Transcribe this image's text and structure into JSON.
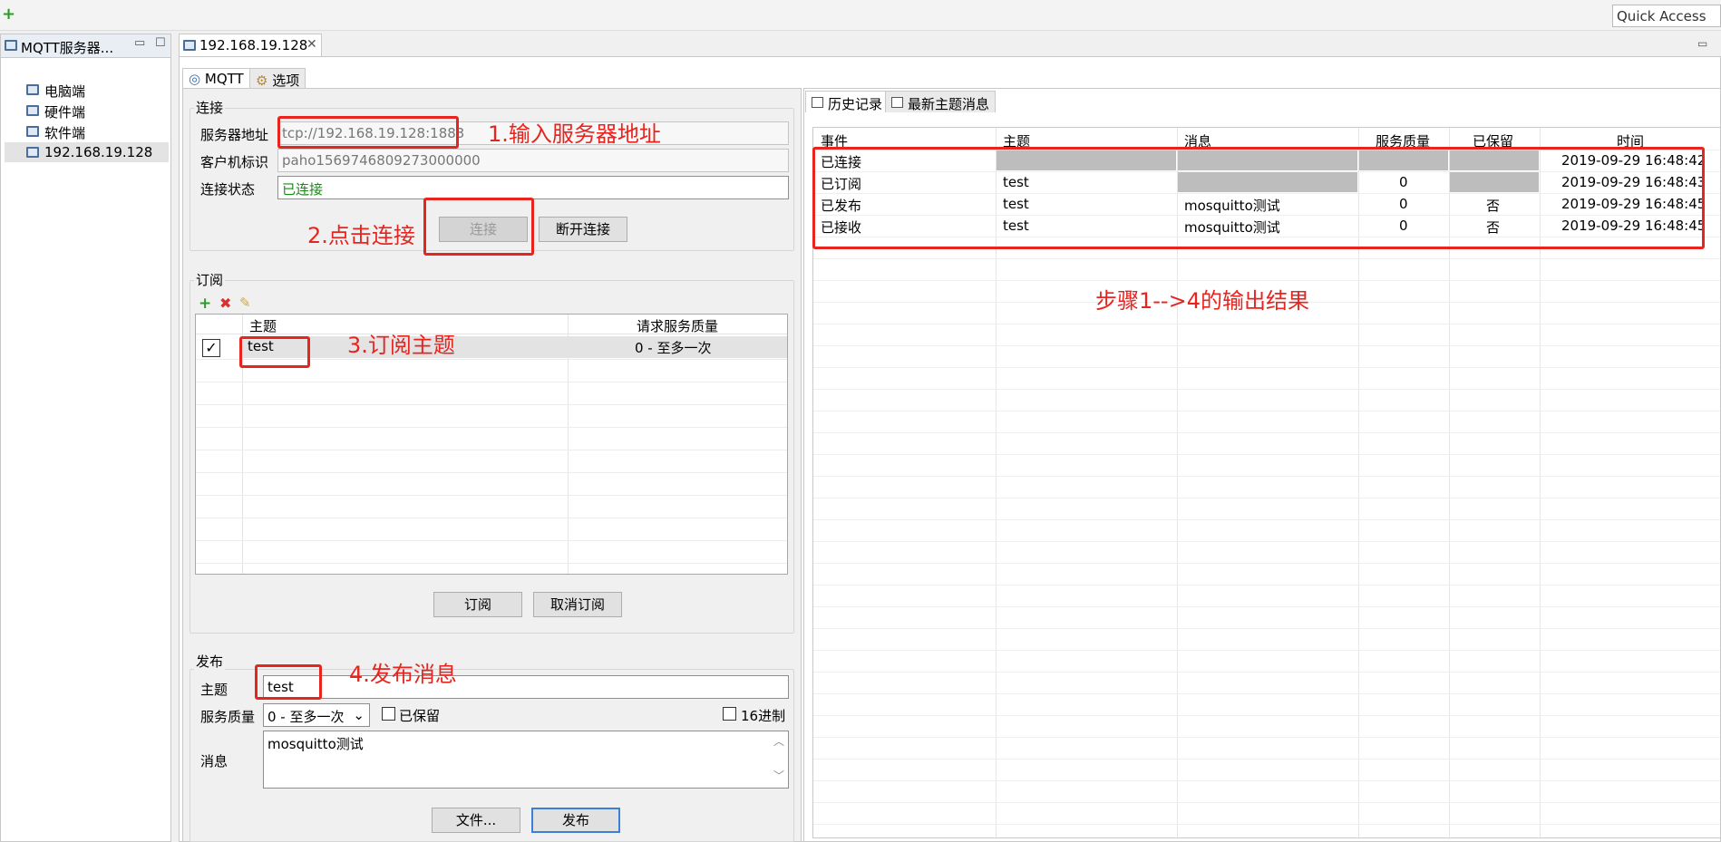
{
  "toolbar": {
    "quick_access_placeholder": "Quick Access"
  },
  "left_panel": {
    "title": "MQTT服务器...",
    "items": [
      "电脑端",
      "硬件端",
      "软件端",
      "192.168.19.128"
    ]
  },
  "editor": {
    "tab_title": "192.168.19.128",
    "inner_tabs": [
      "MQTT",
      "选项"
    ]
  },
  "connection": {
    "group_title": "连接",
    "server_label": "服务器地址",
    "server_value": "tcp://192.168.19.128:1883",
    "client_label": "客户机标识",
    "client_value": "paho1569746809273000000",
    "status_label": "连接状态",
    "status_value": "已连接",
    "connect_btn": "连接",
    "disconnect_btn": "断开连接"
  },
  "subscribe": {
    "group_title": "订阅",
    "col_topic": "主题",
    "col_qos": "请求服务质量",
    "rows": [
      {
        "checked": true,
        "topic": "test",
        "qos": "0 - 至多一次"
      }
    ],
    "subscribe_btn": "订阅",
    "unsubscribe_btn": "取消订阅"
  },
  "publish": {
    "group_title": "发布",
    "topic_label": "主题",
    "topic_value": "test",
    "qos_label": "服务质量",
    "qos_value": "0 - 至多一次",
    "retain_label": "已保留",
    "hex_label": "16进制",
    "message_label": "消息",
    "message_value": "mosquitto测试",
    "file_btn": "文件...",
    "publish_btn": "发布"
  },
  "history": {
    "tabs": [
      "历史记录",
      "最新主题消息"
    ],
    "columns": [
      "事件",
      "主题",
      "消息",
      "服务质量",
      "已保留",
      "时间"
    ],
    "rows": [
      {
        "event": "已连接",
        "topic": "",
        "message": "",
        "qos": "",
        "retained": "",
        "time": "2019-09-29 16:48:42"
      },
      {
        "event": "已订阅",
        "topic": "test",
        "message": "",
        "qos": "0",
        "retained": "",
        "time": "2019-09-29 16:48:43"
      },
      {
        "event": "已发布",
        "topic": "test",
        "message": "mosquitto测试",
        "qos": "0",
        "retained": "否",
        "time": "2019-09-29 16:48:45"
      },
      {
        "event": "已接收",
        "topic": "test",
        "message": "mosquitto测试",
        "qos": "0",
        "retained": "否",
        "time": "2019-09-29 16:48:45"
      }
    ]
  },
  "annotations": {
    "step1": "1.输入服务器地址",
    "step2": "2.点击连接",
    "step3": "3.订阅主题",
    "step4": "4.发布消息",
    "result": "步骤1-->4的输出结果"
  },
  "colors": {
    "annotation_red": "#e8241f",
    "status_green": "#1a8a1a",
    "default_button_border": "#3c7fd6"
  }
}
